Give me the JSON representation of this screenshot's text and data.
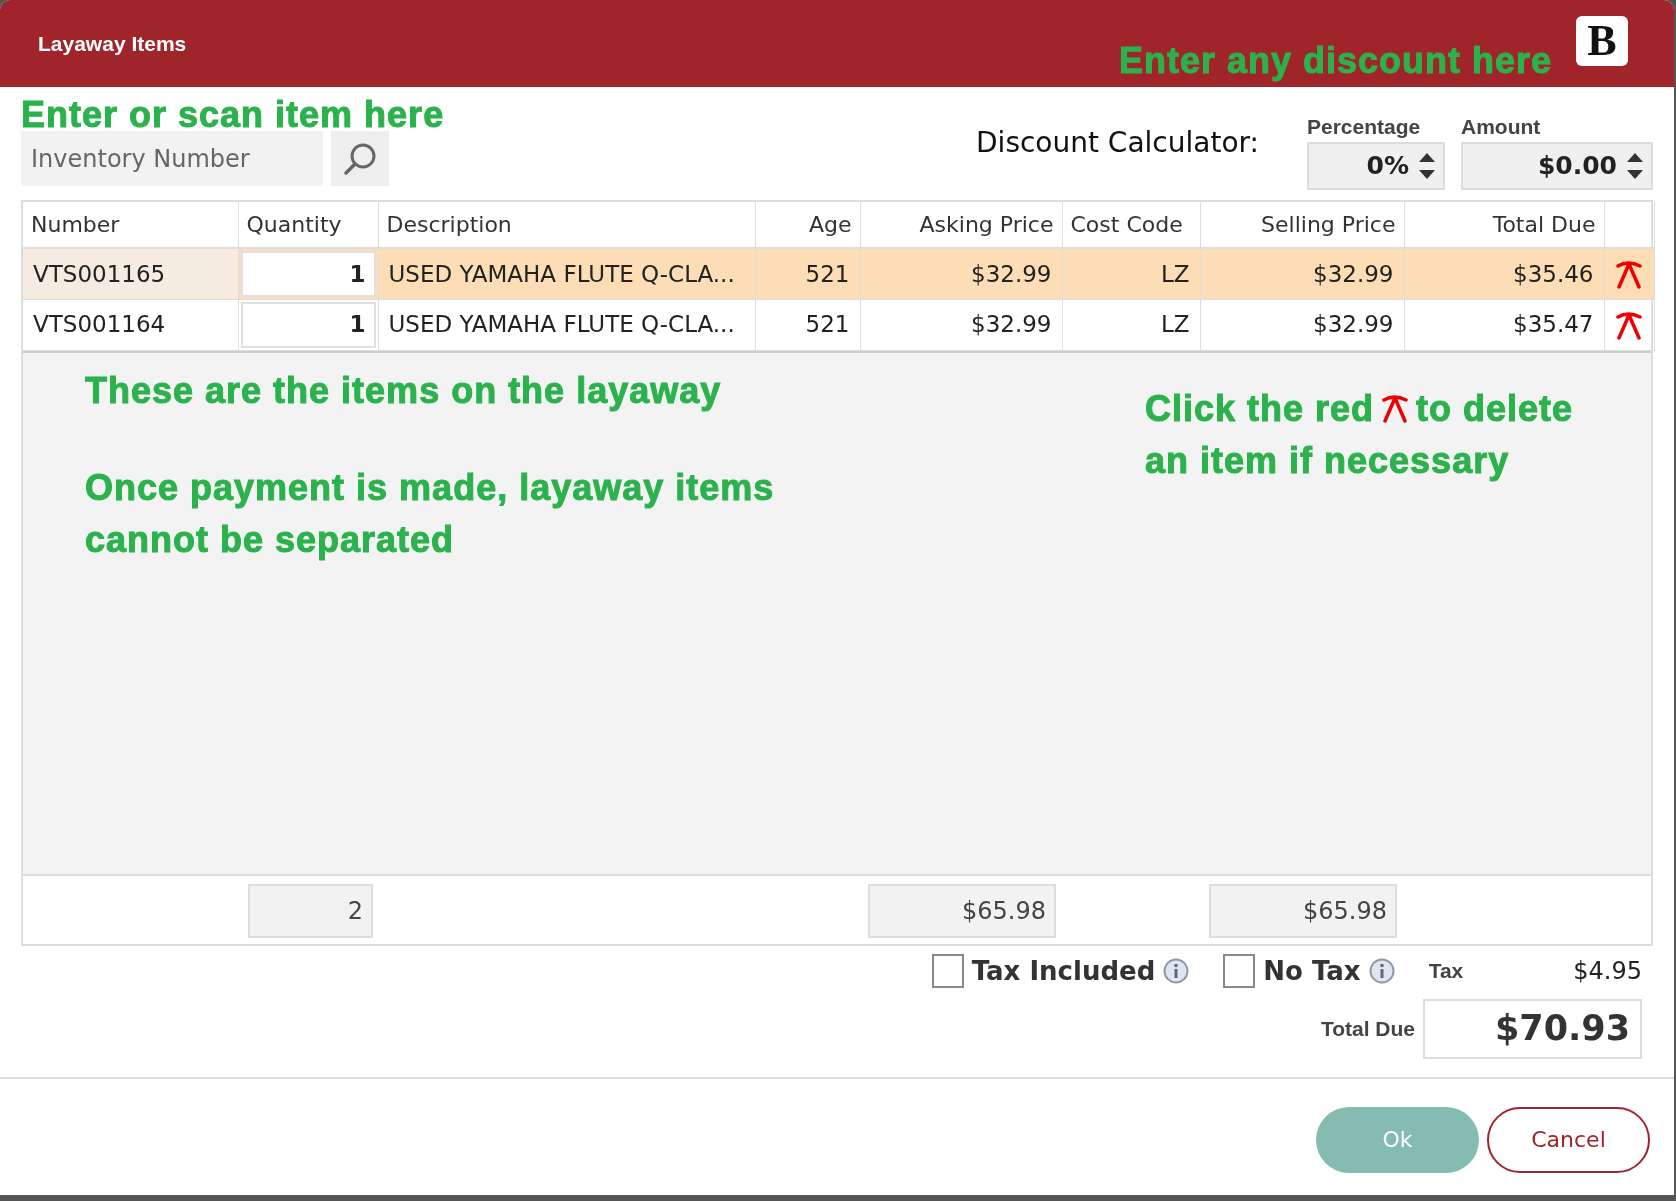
{
  "window": {
    "title": "Layaway Items",
    "logo_text": "B"
  },
  "annotations": {
    "scan": "Enter or scan item here",
    "discount": "Enter any discount here",
    "items": "These are the items on the layaway",
    "payment": "Once payment is made, layaway items cannot be separated",
    "delete_before": "Click the red",
    "delete_after": "to delete",
    "delete_line2": "an item if necessary"
  },
  "search": {
    "placeholder": "Inventory Number"
  },
  "discount": {
    "label": "Discount Calculator:",
    "percentage": {
      "label": "Percentage",
      "value": "0%"
    },
    "amount": {
      "label": "Amount",
      "value": "$0.00"
    }
  },
  "table": {
    "columns": [
      "Number",
      "Quantity",
      "Description",
      "Age",
      "Asking Price",
      "Cost Code",
      "Selling Price",
      "Total Due"
    ],
    "rows": [
      {
        "number": "VTS001165",
        "quantity": "1",
        "description": "USED YAMAHA FLUTE Q-CLA...",
        "age": "521",
        "asking_price": "$32.99",
        "cost_code": "LZ",
        "selling_price": "$32.99",
        "total_due": "$35.46",
        "selected": true
      },
      {
        "number": "VTS001164",
        "quantity": "1",
        "description": "USED YAMAHA FLUTE Q-CLA...",
        "age": "521",
        "asking_price": "$32.99",
        "cost_code": "LZ",
        "selling_price": "$32.99",
        "total_due": "$35.47",
        "selected": false
      }
    ],
    "totals": {
      "quantity": "2",
      "asking_price": "$65.98",
      "selling_price": "$65.98"
    }
  },
  "options": [
    {
      "label": "Tax Included",
      "checked": false
    },
    {
      "label": "No Tax",
      "checked": false
    }
  ],
  "tax": {
    "label": "Tax",
    "value": "$4.95"
  },
  "total_due": {
    "label": "Total Due",
    "value": "$70.93"
  },
  "buttons": [
    {
      "label": "Ok",
      "kind": "primary"
    },
    {
      "label": "Cancel",
      "kind": "secondary"
    }
  ]
}
